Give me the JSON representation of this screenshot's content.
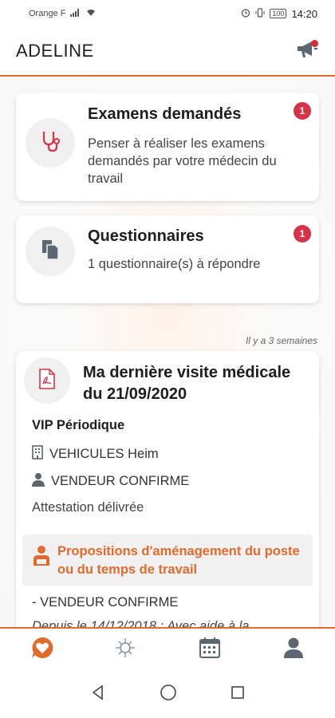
{
  "status_bar": {
    "carrier": "Orange F",
    "battery": "100",
    "time": "14:20"
  },
  "header": {
    "title": "ADELINE",
    "notification_icon": "megaphone-icon"
  },
  "cards": {
    "exams": {
      "title": "Examens demandés",
      "text": "Penser à réaliser les examens demandés par votre médecin du travail",
      "badge": "1",
      "icon": "stethoscope-icon"
    },
    "questionnaires": {
      "title": "Questionnaires",
      "text": "1 questionnaire(s) à répondre",
      "badge": "1",
      "icon": "documents-icon"
    }
  },
  "visit": {
    "timestamp": "Il y a 3 semaines",
    "title": "Ma dernière visite médicale du 21/09/2020",
    "icon": "pdf-icon",
    "type": "VIP Périodique",
    "company": "VEHICULES Heim",
    "job": "VENDEUR CONFIRME",
    "status": "Attestation délivrée",
    "proposal_title": "Propositions d'aménagement du poste ou du temps de travail",
    "proposal_job": "- VENDEUR CONFIRME",
    "proposal_detail": "Depuis le 14/12/2018 : Avec aide à la"
  },
  "bottom_nav": [
    {
      "icon": "heart-chat-icon",
      "active": true
    },
    {
      "icon": "virus-icon",
      "active": false
    },
    {
      "icon": "calendar-icon",
      "active": false
    },
    {
      "icon": "profile-icon",
      "active": false
    }
  ],
  "colors": {
    "accent": "#e26a2c",
    "badge": "#d63348",
    "icon_gray": "#5b6670"
  }
}
